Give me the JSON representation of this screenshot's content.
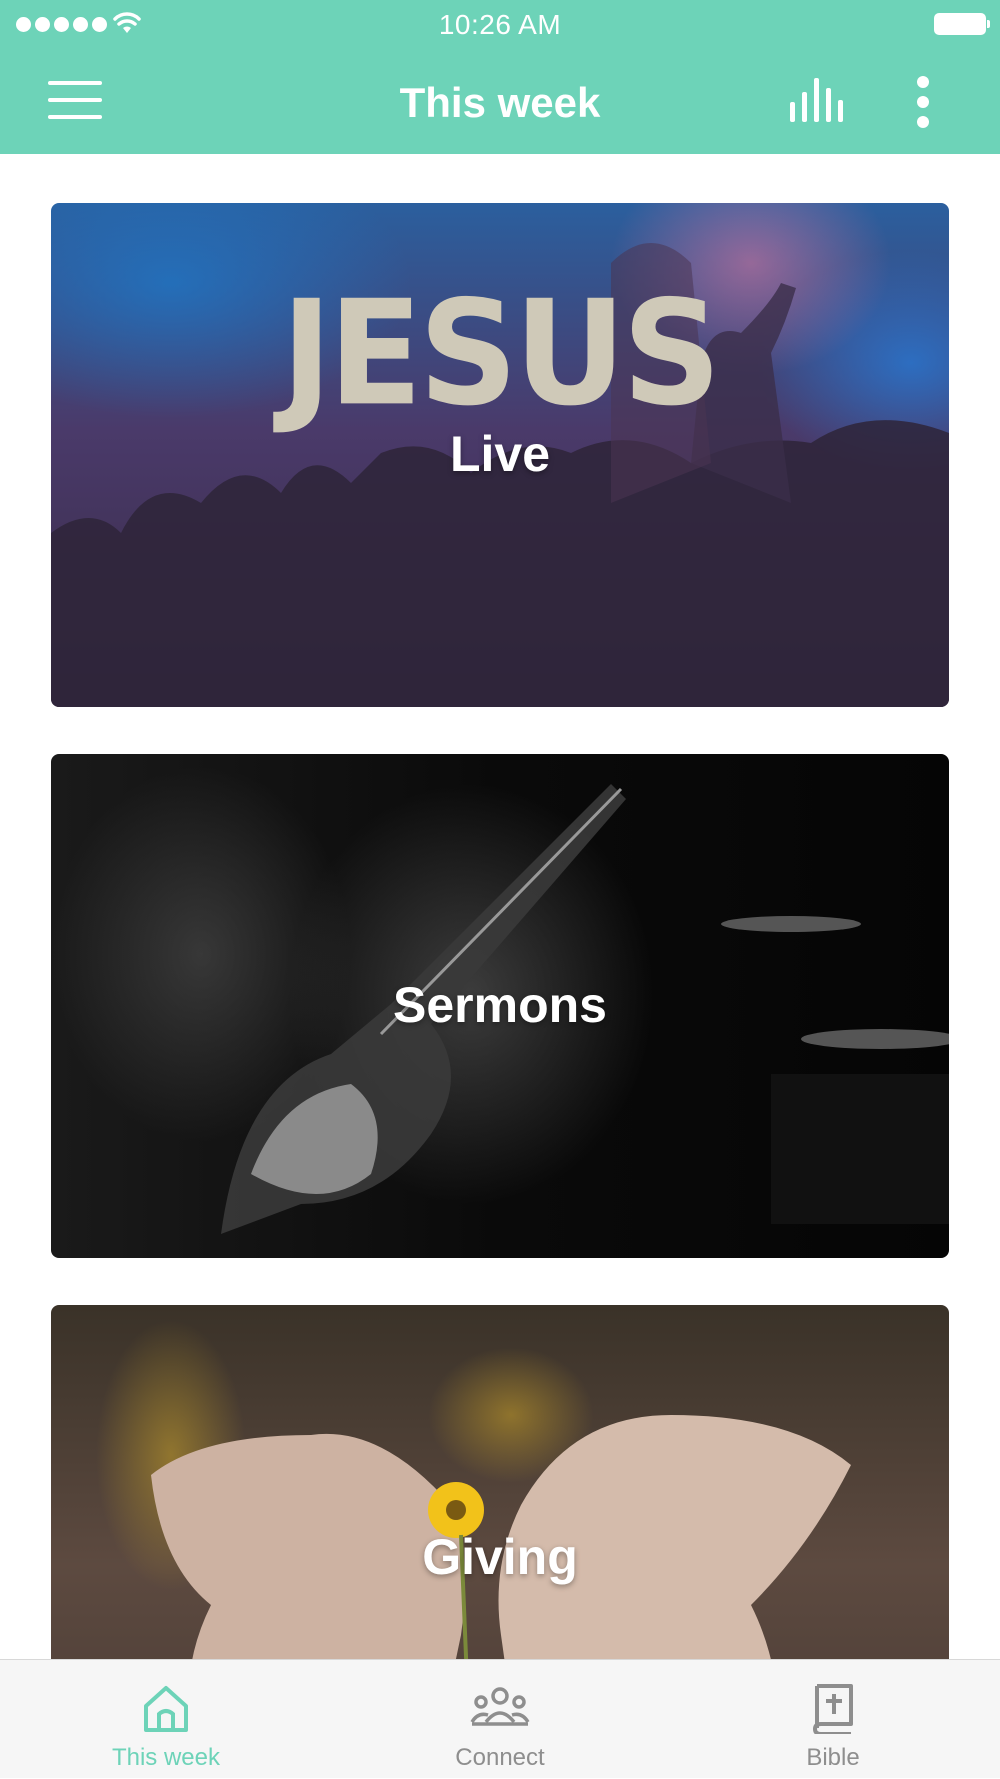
{
  "status_bar": {
    "time": "10:26 AM"
  },
  "header": {
    "title": "This week",
    "menu_icon": "hamburger-icon",
    "stats_icon": "bar-chart-icon",
    "more_icon": "more-vertical-icon"
  },
  "cards": [
    {
      "label": "Live",
      "image_text": "JESUS"
    },
    {
      "label": "Sermons"
    },
    {
      "label": "Giving"
    }
  ],
  "tabbar": {
    "tabs": [
      {
        "label": "This week",
        "icon": "home-icon",
        "active": true
      },
      {
        "label": "Connect",
        "icon": "people-icon",
        "active": false
      },
      {
        "label": "Bible",
        "icon": "bible-icon",
        "active": false
      }
    ]
  },
  "colors": {
    "accent": "#6dd3b8",
    "inactive": "#8e8e8e"
  }
}
